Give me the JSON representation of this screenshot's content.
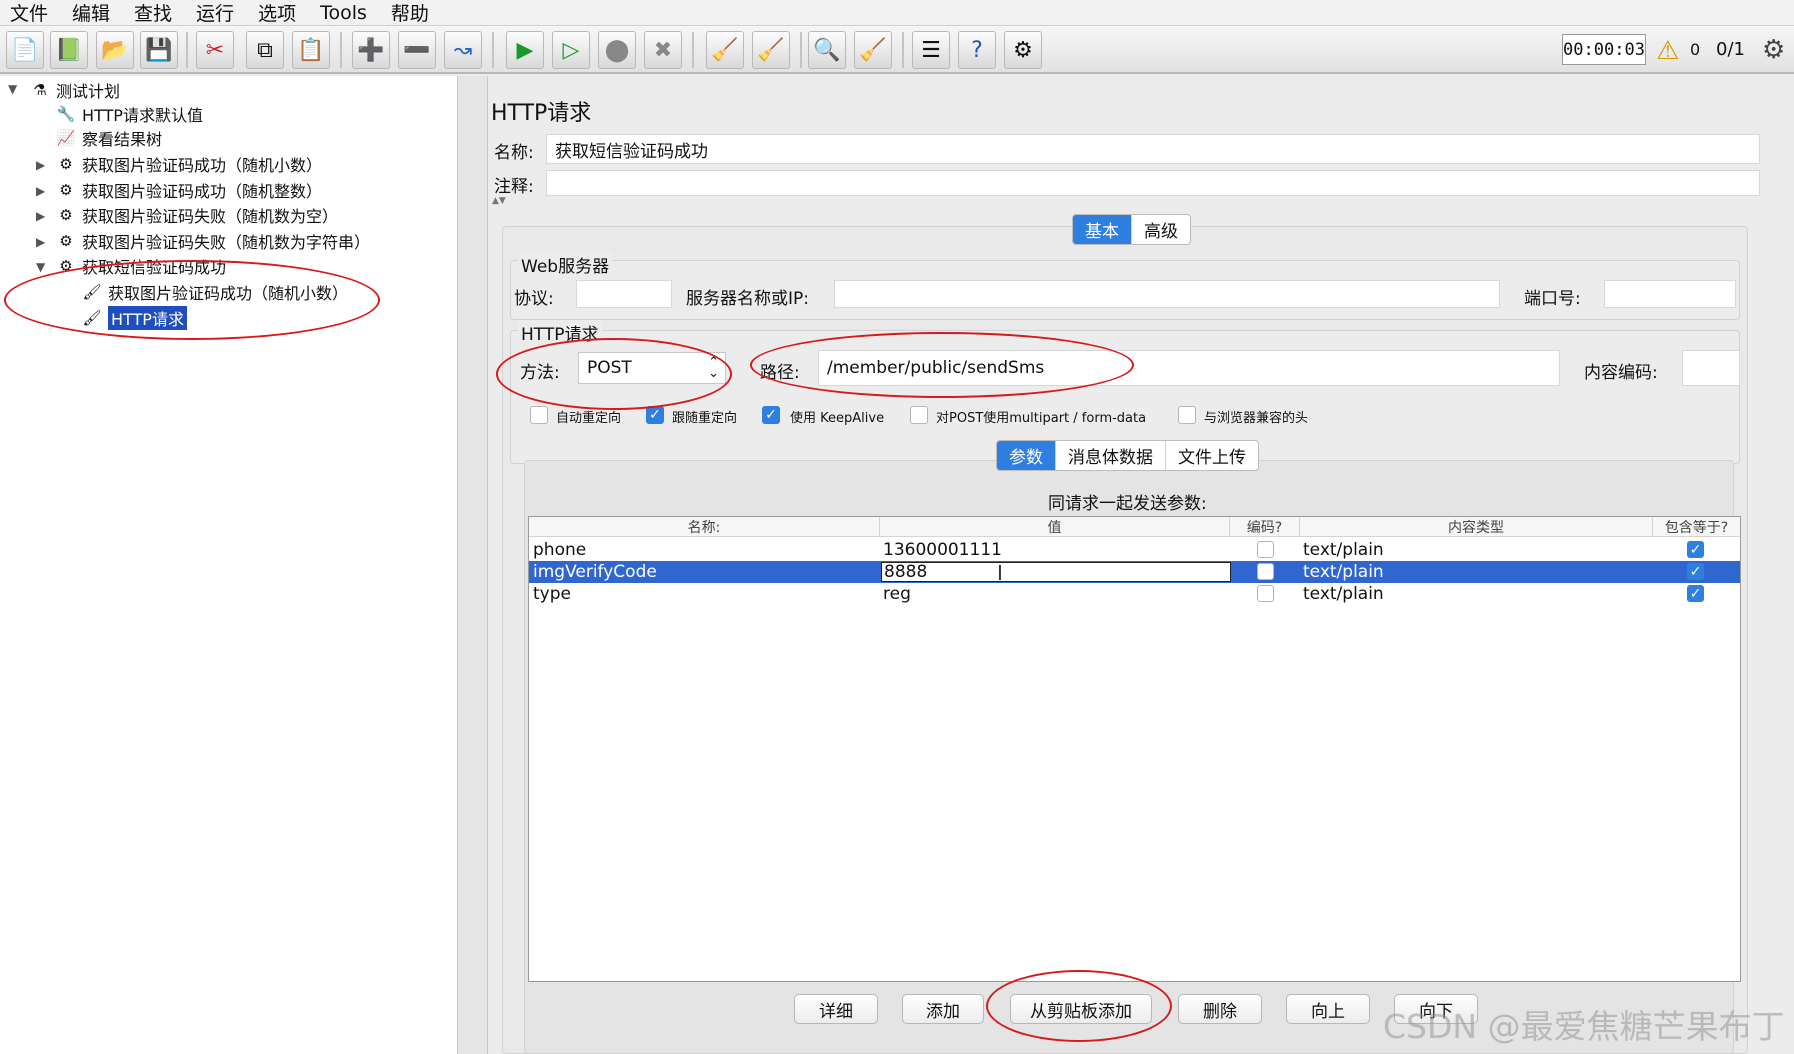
{
  "menu": [
    "文件",
    "编辑",
    "查找",
    "运行",
    "选项",
    "Tools",
    "帮助"
  ],
  "toolbar": {
    "timer": "00:00:03",
    "warning_count": "0",
    "thread_count": "0/1"
  },
  "tree": {
    "root": "测试计划",
    "items": [
      "HTTP请求默认值",
      "察看结果树",
      "获取图片验证码成功（随机小数）",
      "获取图片验证码成功（随机整数）",
      "获取图片验证码失败（随机数为空）",
      "获取图片验证码失败（随机数为字符串）",
      "获取短信验证码成功"
    ],
    "children": [
      "获取图片验证码成功（随机小数）",
      "HTTP请求"
    ]
  },
  "panel": {
    "title": "HTTP请求",
    "name_label": "名称:",
    "name_value": "获取短信验证码成功",
    "comment_label": "注释:",
    "tabs": [
      "基本",
      "高级"
    ],
    "web_server": {
      "title": "Web服务器",
      "protocol_label": "协议:",
      "server_label": "服务器名称或IP:",
      "port_label": "端口号:"
    },
    "http_request": {
      "title": "HTTP请求",
      "method_label": "方法:",
      "method_value": "POST",
      "path_label": "路径:",
      "path_value": "/member/public/sendSms",
      "encoding_label": "内容编码:"
    },
    "checkboxes": [
      {
        "label": "自动重定向",
        "checked": false
      },
      {
        "label": "跟随重定向",
        "checked": true
      },
      {
        "label": "使用 KeepAlive",
        "checked": true
      },
      {
        "label": "对POST使用multipart / form-data",
        "checked": false
      },
      {
        "label": "与浏览器兼容的头",
        "checked": false
      }
    ],
    "subtabs": [
      "参数",
      "消息体数据",
      "文件上传"
    ],
    "params_caption": "同请求一起发送参数:",
    "columns": [
      "名称:",
      "值",
      "编码?",
      "内容类型",
      "包含等于?"
    ],
    "rows": [
      {
        "name": "phone",
        "value": "13600001111",
        "encode": false,
        "type": "text/plain",
        "include_equals": true
      },
      {
        "name": "imgVerifyCode",
        "value": "8888",
        "encode": false,
        "type": "text/plain",
        "include_equals": true
      },
      {
        "name": "type",
        "value": "reg",
        "encode": false,
        "type": "text/plain",
        "include_equals": true
      }
    ],
    "buttons": [
      "详细",
      "添加",
      "从剪贴板添加",
      "删除",
      "向上",
      "向下"
    ]
  },
  "watermark": "CSDN @最爱焦糖芒果布丁"
}
